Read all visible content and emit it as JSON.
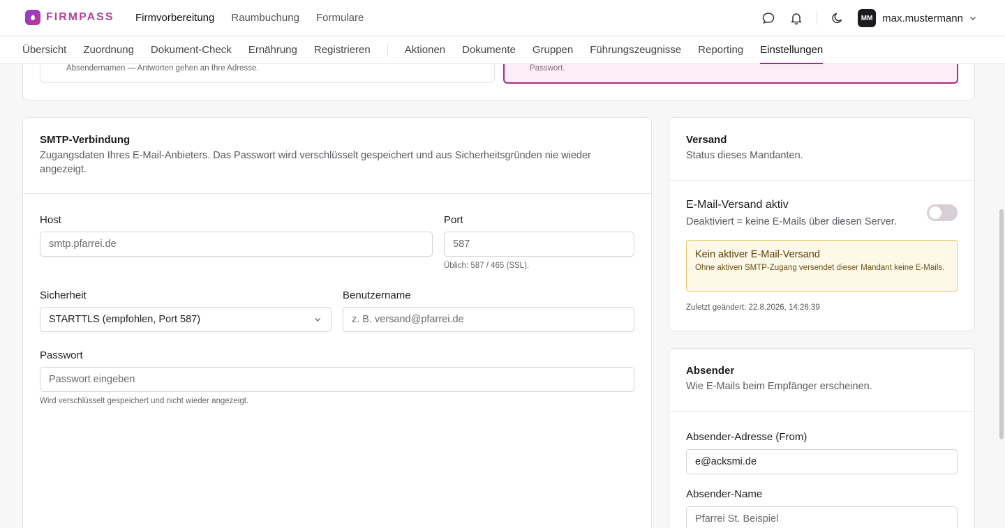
{
  "header": {
    "brand": "FIRMPASS",
    "nav": [
      "Firmvorbereitung",
      "Raumbuchung",
      "Formulare"
    ],
    "avatar_initials": "MM",
    "username": "max.mustermann"
  },
  "subnav": {
    "group1": [
      "Übersicht",
      "Zuordnung",
      "Dokument-Check",
      "Ernährung",
      "Registrieren"
    ],
    "group2": [
      "Aktionen",
      "Dokumente",
      "Gruppen",
      "Führungszeugnisse",
      "Reporting",
      "Einstellungen"
    ]
  },
  "top_hints": {
    "left": "Absendernamen — Antworten gehen an Ihre Adresse.",
    "right": "Passwort."
  },
  "smtp": {
    "title": "SMTP-Verbindung",
    "desc": "Zugangsdaten Ihres E-Mail-Anbieters. Das Passwort wird verschlüsselt gespeichert und aus Sicherheitsgründen nie wieder angezeigt.",
    "host_label": "Host",
    "host_placeholder": "smtp.pfarrei.de",
    "port_label": "Port",
    "port_placeholder": "587",
    "port_help": "Üblich: 587 / 465 (SSL).",
    "security_label": "Sicherheit",
    "security_value": "STARTTLS (empfohlen, Port 587)",
    "username_label": "Benutzername",
    "username_placeholder": "z. B. versand@pfarrei.de",
    "password_label": "Passwort",
    "password_placeholder": "Passwort eingeben",
    "password_help": "Wird verschlüsselt gespeichert und nicht wieder angezeigt."
  },
  "versand": {
    "title": "Versand",
    "desc": "Status dieses Mandanten.",
    "toggle_label": "E-Mail-Versand aktiv",
    "toggle_desc": "Deaktiviert = keine E-Mails über diesen Server.",
    "toggle_on": false,
    "warn_title": "Kein aktiver E-Mail-Versand",
    "warn_text": "Ohne aktiven SMTP-Zugang versendet dieser Mandant keine E-Mails.",
    "last_changed": "Zuletzt geändert: 22.8.2026, 14:26:39"
  },
  "absender": {
    "title": "Absender",
    "desc": "Wie E-Mails beim Empfänger erscheinen.",
    "from_label": "Absender-Adresse (From)",
    "from_value": "e@acksmi.de",
    "name_label": "Absender-Name",
    "name_placeholder": "Pfarrei St. Beispiel"
  },
  "colors": {
    "accent": "#b0277f",
    "brand": "#b0459a",
    "warn_bg": "#fef8e8",
    "warn_border": "#e8c768"
  }
}
